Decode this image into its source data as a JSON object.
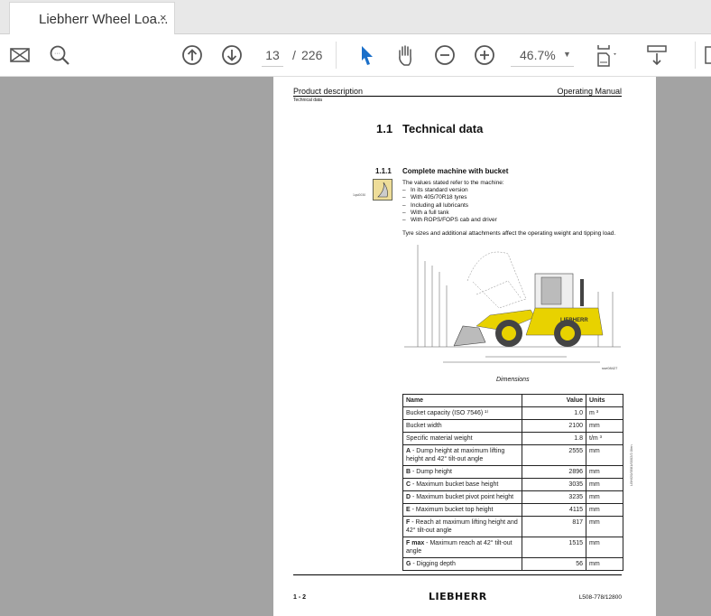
{
  "tab": {
    "title": "Liebherr Wheel Loa...",
    "close": "×"
  },
  "toolbar": {
    "page_current": "13",
    "page_sep": "/",
    "page_total": "226",
    "zoom": "46.7%"
  },
  "doc": {
    "header_left": "Product description",
    "header_right": "Operating Manual",
    "header_sub": "Technical data",
    "section_num": "1.1",
    "section_title": "Technical data",
    "sub_num": "1.1.1",
    "sub_title": "Complete machine with bucket",
    "icon_label": "1qsi0030",
    "intro": "The values stated refer to the machine:",
    "bullets": [
      "In its standard version",
      "With 405/70R18 tyres",
      "Including all lubricants",
      "With a full tank",
      "With ROPS/FOPS cab and driver"
    ],
    "para": "Tyre sizes and additional attachments affect the operating weight and tipping load.",
    "figure_id": "sse08427",
    "figure_caption": "Dimensions",
    "side_code": "LBH/20/3581/0002/2.0/en",
    "table": {
      "headers": [
        "Name",
        "Value",
        "Units"
      ],
      "rows": [
        {
          "bold": "",
          "name": "Bucket capacity (ISO 7546) ¹⁾",
          "value": "1.0",
          "unit": "m ³"
        },
        {
          "bold": "",
          "name": "Bucket width",
          "value": "2100",
          "unit": "mm"
        },
        {
          "bold": "",
          "name": "Specific material weight",
          "value": "1.8",
          "unit": "t/m ³"
        },
        {
          "bold": "A",
          "name": " - Dump height at maximum lifting height and 42° tilt-out angle",
          "value": "2555",
          "unit": "mm"
        },
        {
          "bold": "B",
          "name": " - Dump height",
          "value": "2896",
          "unit": "mm"
        },
        {
          "bold": "C",
          "name": " - Maximum bucket base height",
          "value": "3035",
          "unit": "mm"
        },
        {
          "bold": "D",
          "name": " - Maximum bucket pivot point height",
          "value": "3235",
          "unit": "mm"
        },
        {
          "bold": "E",
          "name": " - Maximum bucket top height",
          "value": "4115",
          "unit": "mm"
        },
        {
          "bold": "F",
          "name": " - Reach at maximum lifting height and 42° tilt-out angle",
          "value": "817",
          "unit": "mm"
        },
        {
          "bold": "F max",
          "name": " - Maximum reach at 42° tilt-out angle",
          "value": "1515",
          "unit": "mm"
        },
        {
          "bold": "G",
          "name": " - Digging depth",
          "value": "56",
          "unit": "mm"
        }
      ]
    },
    "footer_left": "1 - 2",
    "footer_logo": "LIEBHERR",
    "footer_right": "L508-778/12800"
  }
}
